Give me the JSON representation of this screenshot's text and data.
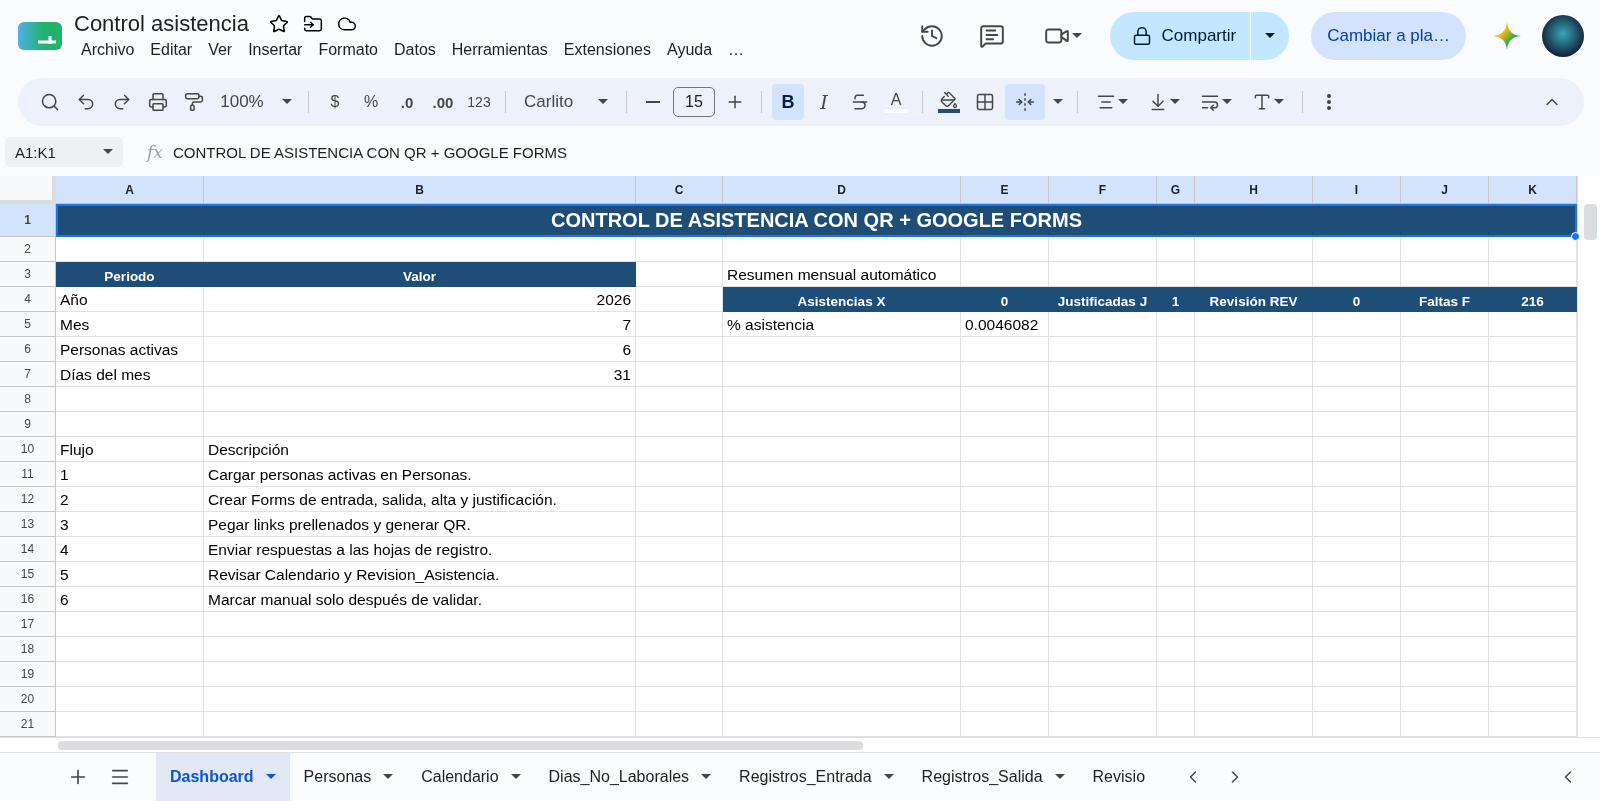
{
  "document": {
    "title": "Control asistencia"
  },
  "menus": [
    "Archivo",
    "Editar",
    "Ver",
    "Insertar",
    "Formato",
    "Datos",
    "Herramientas",
    "Extensiones",
    "Ayuda"
  ],
  "menu_more": "…",
  "share_button": "Compartir",
  "switch_button": "Cambiar a pla…",
  "toolbar": {
    "zoom": "100%",
    "currency": "$",
    "percent": "%",
    "decrease_decimals": ".0",
    "increase_decimals": ".00",
    "number_format": "123",
    "font": "Carlito",
    "font_size": "15",
    "bold": {
      "label": "B",
      "on": true
    },
    "italic": {
      "label": "I",
      "on": false
    },
    "text_color": {
      "label": "A"
    },
    "merge": {
      "on": true
    }
  },
  "formula_bar": {
    "name_box": "A1:K1",
    "fx": "fx",
    "formula": "CONTROL DE ASISTENCIA CON QR + GOOGLE FORMS"
  },
  "columns": [
    {
      "label": "A",
      "selected": true
    },
    {
      "label": "B",
      "selected": true
    },
    {
      "label": "C",
      "selected": true
    },
    {
      "label": "D",
      "selected": true
    },
    {
      "label": "E",
      "selected": true
    },
    {
      "label": "F",
      "selected": true
    },
    {
      "label": "G",
      "selected": true
    },
    {
      "label": "H",
      "selected": true
    },
    {
      "label": "I",
      "selected": true
    },
    {
      "label": "J",
      "selected": true
    },
    {
      "label": "K",
      "selected": true
    }
  ],
  "rows": [
    {
      "label": "1",
      "selected": true
    },
    {
      "label": "2",
      "selected": false
    },
    {
      "label": "3",
      "selected": false
    },
    {
      "label": "4",
      "selected": false
    },
    {
      "label": "5",
      "selected": false
    },
    {
      "label": "6",
      "selected": false
    },
    {
      "label": "7",
      "selected": false
    },
    {
      "label": "8",
      "selected": false
    },
    {
      "label": "9",
      "selected": false
    },
    {
      "label": "10",
      "selected": false
    },
    {
      "label": "11",
      "selected": false
    },
    {
      "label": "12",
      "selected": false
    },
    {
      "label": "13",
      "selected": false
    },
    {
      "label": "14",
      "selected": false
    },
    {
      "label": "15",
      "selected": false
    },
    {
      "label": "16",
      "selected": false
    },
    {
      "label": "17",
      "selected": false
    },
    {
      "label": "18",
      "selected": false
    },
    {
      "label": "19",
      "selected": false
    },
    {
      "label": "20",
      "selected": false
    },
    {
      "label": "21",
      "selected": false
    }
  ],
  "title_cell": "CONTROL DE ASISTENCIA CON QR + GOOGLE FORMS",
  "period_table": {
    "columns": [
      "Periodo",
      "Valor"
    ],
    "rows": [
      {
        "label": "Año",
        "value": "2026"
      },
      {
        "label": "Mes",
        "value": "7"
      },
      {
        "label": "Personas activas",
        "value": "6"
      },
      {
        "label": "Días del mes",
        "value": "31"
      }
    ]
  },
  "summary": {
    "title": "Resumen mensual automático",
    "metrics": [
      "Asistencias X",
      "0",
      "Justificadas J",
      "1",
      "Revisión REV",
      "0",
      "Faltas F",
      "216"
    ],
    "percent_label": "% asistencia",
    "percent_value": "0.0046082"
  },
  "flow_table": {
    "columns": [
      "Flujo",
      "Descripción"
    ],
    "rows": [
      {
        "step": "1",
        "text": "Cargar personas activas en Personas."
      },
      {
        "step": "2",
        "text": "Crear Forms de entrada, salida, alta y justificación."
      },
      {
        "step": "3",
        "text": "Pegar links prellenados y generar QR."
      },
      {
        "step": "4",
        "text": "Enviar respuestas a las hojas de registro."
      },
      {
        "step": "5",
        "text": "Revisar Calendario y Revision_Asistencia."
      },
      {
        "step": "6",
        "text": "Marcar manual solo después de validar."
      }
    ]
  },
  "sheet_tabs": [
    {
      "label": "Dashboard",
      "selected": true
    },
    {
      "label": "Personas",
      "selected": false
    },
    {
      "label": "Calendario",
      "selected": false
    },
    {
      "label": "Dias_No_Laborales",
      "selected": false
    },
    {
      "label": "Registros_Entrada",
      "selected": false
    },
    {
      "label": "Registros_Salida",
      "selected": false
    },
    {
      "label": "Revisio",
      "selected": false
    }
  ]
}
